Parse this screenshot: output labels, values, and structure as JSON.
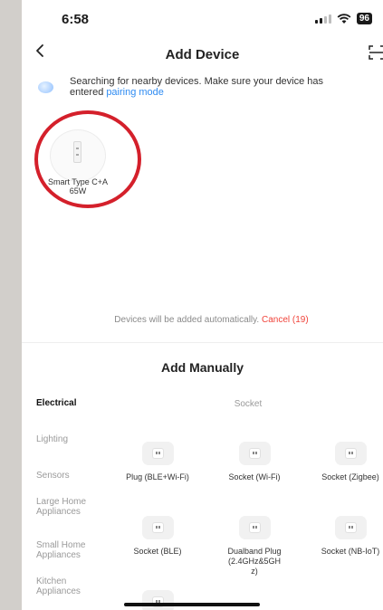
{
  "status_bar": {
    "time": "6:58",
    "battery": "96"
  },
  "header": {
    "back_icon": "chevron-left-icon",
    "title": "Add Device",
    "scan_icon": "scan-icon"
  },
  "searching": {
    "message": "Searching for nearby devices. Make sure your device has entered",
    "link": "pairing mode"
  },
  "found_devices": [
    {
      "name": "Smart Type C+A 65W"
    }
  ],
  "auto_add": {
    "text": "Devices will be added automatically.",
    "cancel": "Cancel (19)"
  },
  "manual": {
    "title": "Add Manually",
    "categories": [
      {
        "label": "Electrical",
        "active": true
      },
      {
        "label": "Lighting"
      },
      {
        "label": "Sensors"
      },
      {
        "label": "Large Home Appliances"
      },
      {
        "label": "Small Home Appliances"
      },
      {
        "label": "Kitchen Appliances"
      }
    ],
    "section_heading": "Socket",
    "items": [
      {
        "label": "Plug (BLE+Wi-Fi)"
      },
      {
        "label": "Socket (Wi-Fi)"
      },
      {
        "label": "Socket (Zigbee)"
      },
      {
        "label": "Socket (BLE)"
      },
      {
        "label": "Dualband Plug (2.4GHz&5GHz)"
      },
      {
        "label": "Socket (NB-IoT)"
      }
    ]
  },
  "colors": {
    "accent_blue": "#2e8bf2",
    "cancel_red": "#f0433a",
    "highlight_red": "#d4202b"
  }
}
